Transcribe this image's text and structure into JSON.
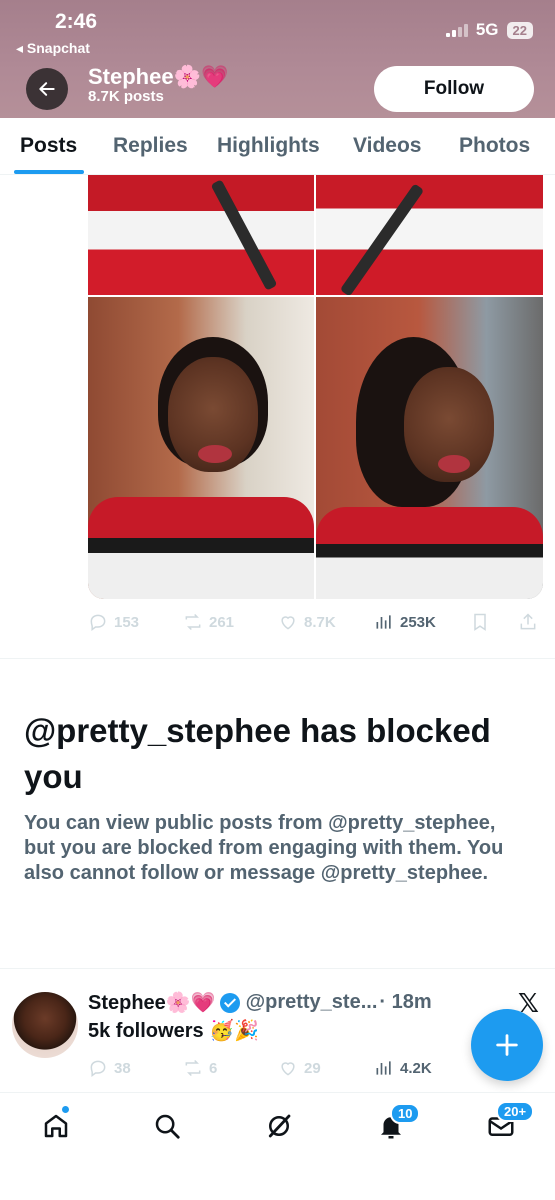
{
  "status_bar": {
    "time": "2:46",
    "back_app": "◂ Snapchat",
    "network": "5G",
    "battery": "22"
  },
  "header": {
    "name": "Stephee🌸💗",
    "posts_count": "8.7K posts",
    "follow_label": "Follow"
  },
  "tabs": [
    "Posts",
    "Replies",
    "Highlights",
    "Videos",
    "Photos"
  ],
  "post1": {
    "replies": "153",
    "reposts": "261",
    "likes": "8.7K",
    "views": "253K"
  },
  "blocked": {
    "title": "@pretty_stephee has blocked you",
    "description": "You can view public posts from @pretty_stephee, but you are blocked from engaging with them. You also cannot follow or message @pretty_stephee."
  },
  "post2": {
    "name": "Stephee🌸💗",
    "handle": "@pretty_ste...",
    "time": "· 18m",
    "text": "5k followers 🥳🎉",
    "replies": "38",
    "reposts": "6",
    "likes": "29",
    "views": "4.2K"
  },
  "bottom_nav": {
    "notifications_badge": "10",
    "messages_badge": "20+"
  },
  "colors": {
    "accent": "#1d9bf0",
    "header_bg": "#a57f8c",
    "muted_text": "#536471"
  }
}
